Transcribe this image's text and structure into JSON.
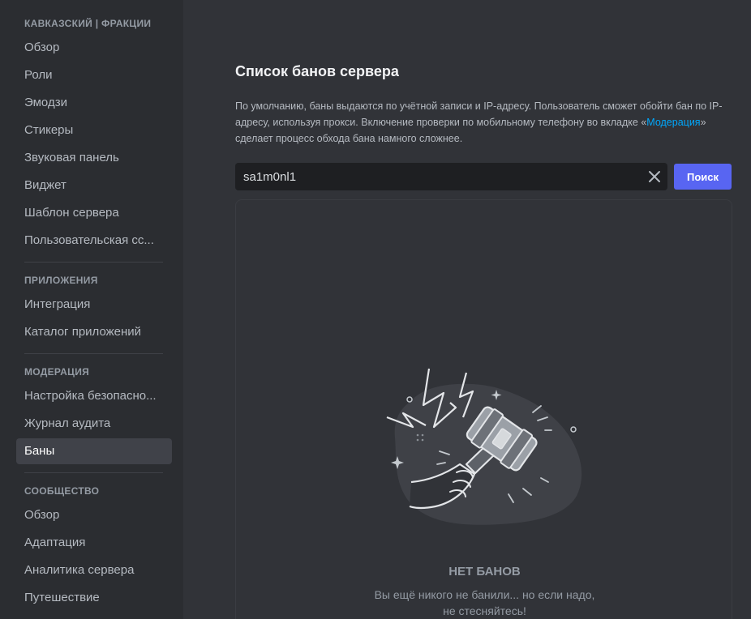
{
  "sidebar": {
    "sections": [
      {
        "header": "КАВКАЗСКИЙ | ФРАКЦИИ",
        "items": [
          "Обзор",
          "Роли",
          "Эмодзи",
          "Стикеры",
          "Звуковая панель",
          "Виджет",
          "Шаблон сервера",
          "Пользовательская сс..."
        ]
      },
      {
        "header": "ПРИЛОЖЕНИЯ",
        "items": [
          "Интеграция",
          "Каталог приложений"
        ]
      },
      {
        "header": "МОДЕРАЦИЯ",
        "items": [
          "Настройка безопасно...",
          "Журнал аудита",
          "Баны"
        ]
      },
      {
        "header": "СООБЩЕСТВО",
        "items": [
          "Обзор",
          "Адаптация",
          "Аналитика сервера",
          "Путешествие"
        ]
      }
    ],
    "active_item": "Баны"
  },
  "main": {
    "title": "Список банов сервера",
    "description": {
      "part1": "По умолчанию, баны выдаются по учётной записи и IP-адресу. Пользователь сможет обойти бан по IP-адресу, используя прокси. Включение проверки по мобильному телефону во вкладке «",
      "link": "Модерация",
      "part2": "» сделает процесс обхода бана намного сложнее."
    },
    "search": {
      "value": "sa1m0nl1",
      "button_label": "Поиск",
      "clear_icon": "close-icon"
    },
    "empty_state": {
      "icon": "ban-hammer-illustration",
      "title": "НЕТ БАНОВ",
      "subtitle_line1": "Вы ещё никого не банили... но если надо,",
      "subtitle_line2": "не стесняйтесь!"
    }
  },
  "colors": {
    "accent": "#5865f2",
    "link": "#00a8fc",
    "sidebar_bg": "#2b2d31",
    "content_bg": "#313338"
  }
}
